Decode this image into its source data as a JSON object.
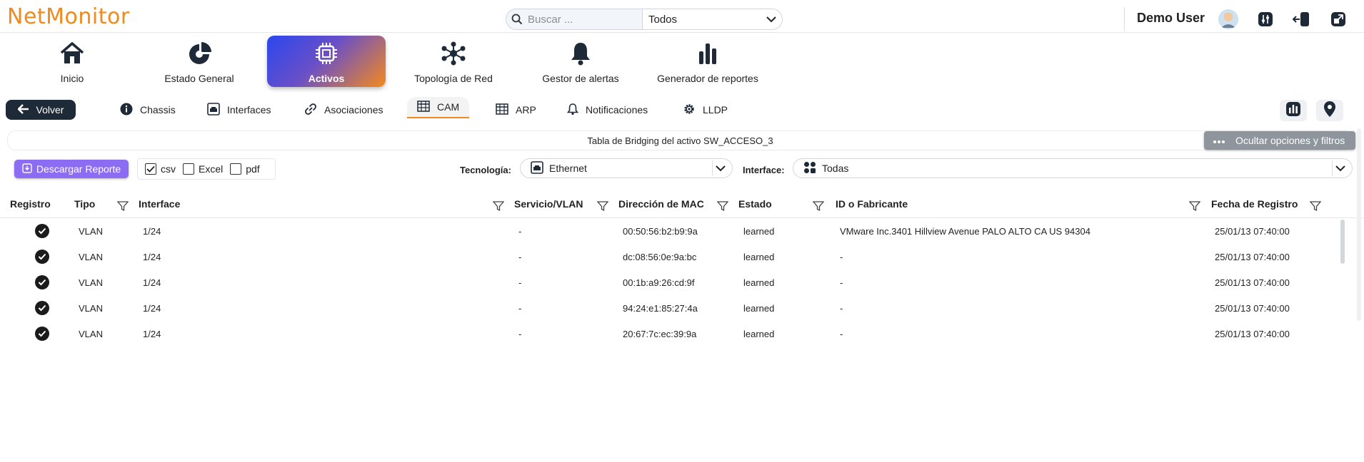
{
  "app": {
    "logo_text": "NetMonitor",
    "brand_color": "#f08a1c"
  },
  "search": {
    "placeholder": "Buscar ...",
    "value": "",
    "scope": "Todos"
  },
  "user": {
    "name": "Demo User",
    "icons": [
      "avatar",
      "sliders-icon",
      "logout-icon",
      "window-icon"
    ]
  },
  "main_nav": [
    {
      "label": "Inicio",
      "icon": "home-icon"
    },
    {
      "label": "Estado General",
      "icon": "pie-chart-icon"
    },
    {
      "label": "Activos",
      "icon": "chip-icon",
      "active": true
    },
    {
      "label": "Topología de Red",
      "icon": "network-icon"
    },
    {
      "label": "Gestor de alertas",
      "icon": "bell-icon"
    },
    {
      "label": "Generador de reportes",
      "icon": "bar-chart-icon"
    }
  ],
  "sub_nav": {
    "back_label": "Volver",
    "items": [
      {
        "label": "Chassis",
        "icon": "info-icon"
      },
      {
        "label": "Interfaces",
        "icon": "ethernet-port-icon"
      },
      {
        "label": "Asociaciones",
        "icon": "link-icon"
      },
      {
        "label": "CAM",
        "icon": "table-icon",
        "active": true
      },
      {
        "label": "ARP",
        "icon": "table-icon"
      },
      {
        "label": "Notificaciones",
        "icon": "bell-icon"
      },
      {
        "label": "LLDP",
        "icon": "gear-icon"
      }
    ]
  },
  "title": "Tabla de Bridging del activo SW_ACCESO_3",
  "filters_toggle": "Ocultar opciones y filtros",
  "download": {
    "label": "Descargar Reporte",
    "formats": [
      {
        "label": "csv",
        "checked": true
      },
      {
        "label": "Excel",
        "checked": false
      },
      {
        "label": "pdf",
        "checked": false
      }
    ]
  },
  "filters": {
    "technology_label": "Tecnología:",
    "technology_value": "Ethernet",
    "interface_label": "Interface:",
    "interface_value": "Todas"
  },
  "table": {
    "columns": [
      "Registro",
      "Tipo",
      "Interface",
      "Servicio/VLAN",
      "Dirección de MAC",
      "Estado",
      "ID o Fabricante",
      "Fecha de Registro"
    ],
    "rows": [
      {
        "tipo": "VLAN",
        "interface": "1/24",
        "servicio": "-",
        "mac": "00:50:56:b2:b9:9a",
        "estado": "learned",
        "fabricante": "VMware Inc.3401 Hillview Avenue PALO ALTO CA US 94304",
        "fecha": "25/01/13 07:40:00"
      },
      {
        "tipo": "VLAN",
        "interface": "1/24",
        "servicio": "-",
        "mac": "dc:08:56:0e:9a:bc",
        "estado": "learned",
        "fabricante": "-",
        "fecha": "25/01/13 07:40:00"
      },
      {
        "tipo": "VLAN",
        "interface": "1/24",
        "servicio": "-",
        "mac": "00:1b:a9:26:cd:9f",
        "estado": "learned",
        "fabricante": "-",
        "fecha": "25/01/13 07:40:00"
      },
      {
        "tipo": "VLAN",
        "interface": "1/24",
        "servicio": "-",
        "mac": "94:24:e1:85:27:4a",
        "estado": "learned",
        "fabricante": "-",
        "fecha": "25/01/13 07:40:00"
      },
      {
        "tipo": "VLAN",
        "interface": "1/24",
        "servicio": "-",
        "mac": "20:67:7c:ec:39:9a",
        "estado": "learned",
        "fabricante": "-",
        "fecha": "25/01/13 07:40:00"
      }
    ]
  }
}
